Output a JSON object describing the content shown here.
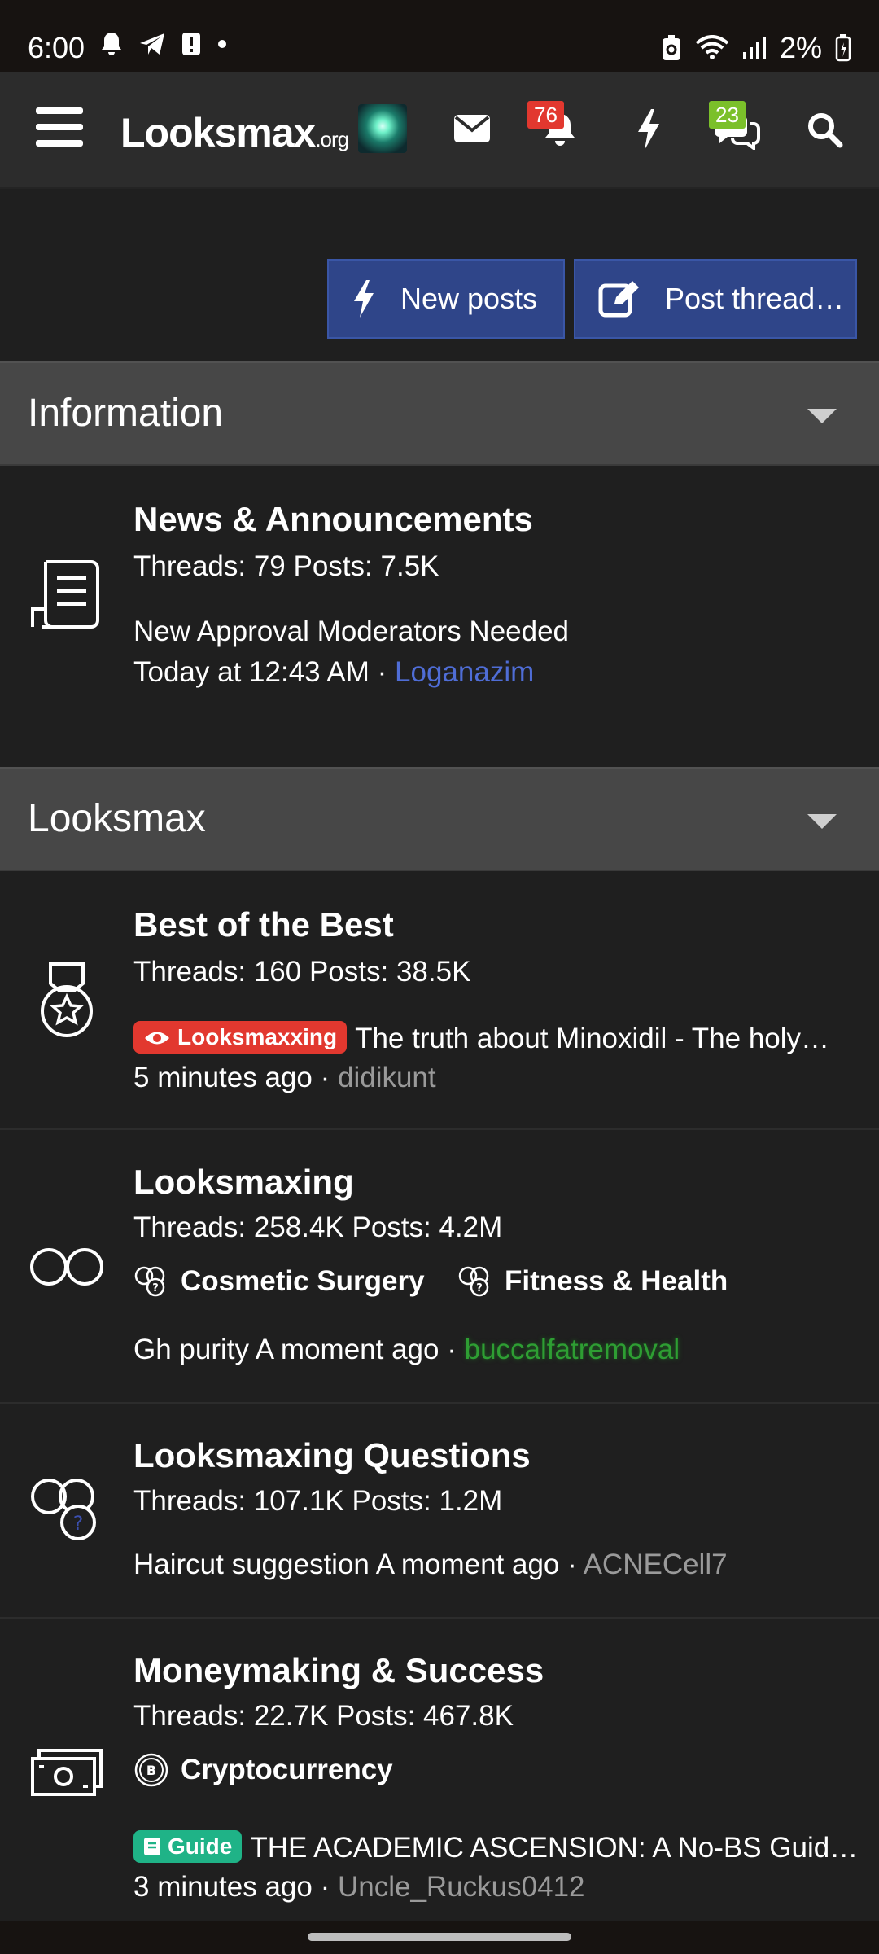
{
  "status_bar": {
    "time": "6:00",
    "battery": "2%",
    "left_icons": [
      "bell-icon",
      "telegram-icon",
      "alert-icon",
      "dot-icon"
    ],
    "right_icons": [
      "battery-saver-icon",
      "wifi-icon",
      "signal-icon",
      "battery-icon"
    ]
  },
  "header": {
    "logo_main": "Looksmax",
    "logo_tld": ".org",
    "alerts_badge": "76",
    "conversations_badge": "23",
    "badge_colors": {
      "alerts": "#e2382f",
      "conversations": "#7bc02a"
    }
  },
  "actions": {
    "new_posts": "New posts",
    "post_thread": "Post thread…"
  },
  "categories": [
    {
      "title": "Information"
    },
    {
      "title": "Looksmax"
    }
  ],
  "forums": [
    {
      "title": "News & Announcements",
      "stats": "Threads: 79 Posts: 7.5K",
      "latest_title": "New Approval Moderators Needed",
      "latest_time": "Today at 12:43 AM",
      "latest_user": "Loganazim"
    },
    {
      "title": "Best of the Best",
      "stats": "Threads: 160 Posts: 38.5K",
      "latest_prefix": "Looksmaxxing",
      "latest_title": "The truth about Minoxidil - The holy…",
      "latest_time": "5 minutes ago",
      "latest_user": "didikunt"
    },
    {
      "title": "Looksmaxing",
      "stats": "Threads: 258.4K Posts: 4.2M",
      "subforums": [
        "Cosmetic Surgery",
        "Fitness & Health"
      ],
      "latest_title": "Gh purity",
      "latest_time": "A moment ago",
      "latest_user": "buccalfatremoval"
    },
    {
      "title": "Looksmaxing Questions",
      "stats": "Threads: 107.1K Posts: 1.2M",
      "latest_title": "Haircut suggestion",
      "latest_time": "A moment ago",
      "latest_user": "ACNECell7"
    },
    {
      "title": "Moneymaking & Success",
      "stats": "Threads: 22.7K Posts: 467.8K",
      "subforums": [
        "Cryptocurrency"
      ],
      "latest_prefix": "Guide",
      "latest_title": "THE ACADEMIC ASCENSION: A No-BS Guid…",
      "latest_time": "3 minutes ago",
      "latest_user": "Uncle_Ruckus0412"
    }
  ],
  "separator": " · ",
  "colors": {
    "button_blue": "#2f4589",
    "prefix_red": "#e2382f",
    "prefix_green": "#1fb387",
    "link_blue": "#4f6dd6"
  }
}
